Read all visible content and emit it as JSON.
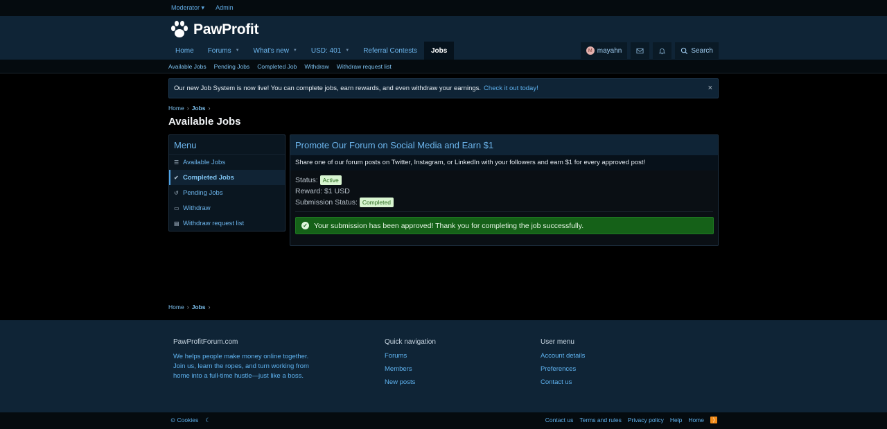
{
  "topbar": {
    "items": [
      "Moderator",
      "Admin"
    ],
    "moderator_chevron": "▾"
  },
  "logo": {
    "text": "PawProfit",
    "icon": "paw-icon"
  },
  "nav": {
    "items": [
      {
        "label": "Home"
      },
      {
        "label": "Forums"
      },
      {
        "label": "What's new"
      },
      {
        "label": "USD: 401"
      },
      {
        "label": "Referral Contests"
      },
      {
        "label": "Jobs"
      }
    ],
    "chevron": "▼"
  },
  "usernav": {
    "avatar_letter": "M",
    "username": "mayahn",
    "search_label": "Search"
  },
  "subnav": {
    "items": [
      "Available Jobs",
      "Pending Jobs",
      "Completed Job",
      "Withdraw",
      "Withdraw request list"
    ]
  },
  "notice": {
    "text": "Our new Job System is now live! You can complete jobs, earn rewards, and even withdraw your earnings.",
    "link": "Check it out today!",
    "close": "×"
  },
  "breadcrumb": {
    "items": [
      "Home",
      "Jobs"
    ],
    "sep": "›"
  },
  "page_title": "Available Jobs",
  "menu": {
    "title": "Menu",
    "items": [
      {
        "label": "Available Jobs",
        "icon": "☰"
      },
      {
        "label": "Completed Jobs",
        "icon": "✔"
      },
      {
        "label": "Pending Jobs",
        "icon": "↺"
      },
      {
        "label": "Withdraw",
        "icon": "▭"
      },
      {
        "label": "Withdraw request list",
        "icon": "▤"
      }
    ]
  },
  "job": {
    "title": "Promote Our Forum on Social Media and Earn $1",
    "description": "Share one of our forum posts on Twitter, Instagram, or LinkedIn with your followers and earn $1 for every approved post!",
    "status_label": "Status:",
    "status_value": "Active",
    "reward_label": "Reward:",
    "reward_value": "$1 USD",
    "submission_label": "Submission Status:",
    "submission_value": "Completed",
    "approved_message": "Your submission has been approved! Thank you for completing the job successfully.",
    "check": "✓"
  },
  "footer": {
    "site": {
      "title": "PawProfitForum.com",
      "text": "We helps people make money online together. Join us, learn the ropes, and turn working from home into a full-time hustle—just like a boss."
    },
    "quick": {
      "title": "Quick navigation",
      "links": [
        "Forums",
        "Members",
        "New posts"
      ]
    },
    "user": {
      "title": "User menu",
      "links": [
        "Account details",
        "Preferences",
        "Contact us"
      ]
    }
  },
  "bottombar": {
    "cookies": "Cookies",
    "links": [
      "Contact us",
      "Terms and rules",
      "Privacy policy",
      "Help",
      "Home"
    ],
    "rss": ")"
  },
  "colors": {
    "header_bg": "#0f2436",
    "accent": "#6cb5ec",
    "success": "#156118"
  }
}
